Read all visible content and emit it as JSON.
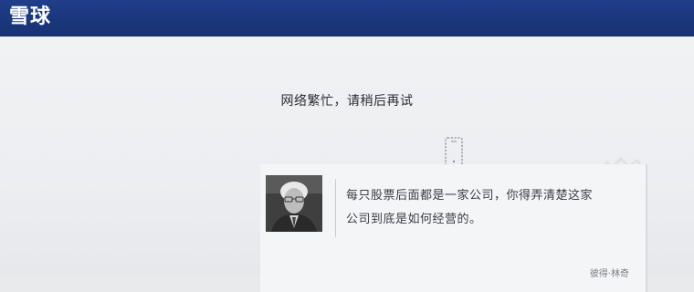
{
  "header": {
    "brand": "雪球"
  },
  "main": {
    "error_message": "网络繁忙，请稍后再试",
    "quote": {
      "text_line1": "每只股票后面都是一家公司，你得弄清楚这家",
      "text_line2": "公司到底是如何经营的。",
      "author": "彼得·林奇"
    }
  },
  "colors": {
    "header_bg": "#1f3f8a",
    "page_bg": "#eceef1",
    "text": "#2a2d33"
  },
  "icons": {
    "loading": "phone-icon",
    "portrait": "portrait-photo"
  }
}
